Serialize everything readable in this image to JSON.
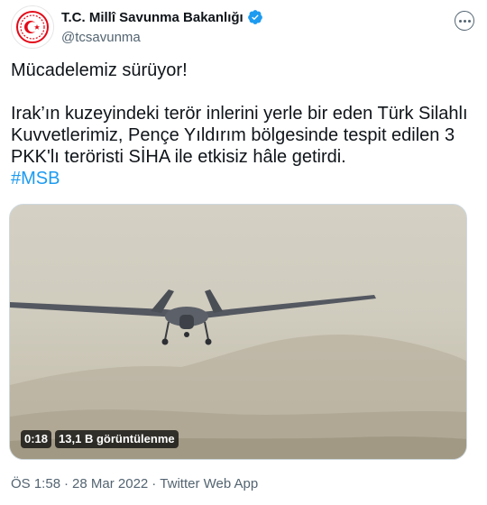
{
  "author": {
    "display_name": "T.C. Millî Savunma Bakanlığı",
    "handle": "@tcsavunma"
  },
  "tweet": {
    "line1": "Mücadelemiz sürüyor!",
    "line2": "Irak’ın kuzeyindeki terör inlerini yerle bir eden Türk Silahlı Kuvvetlerimiz, Pençe Yıldırım bölgesinde tespit edilen 3 PKK'lı teröristi SİHA ile etkisiz hâle getirdi.",
    "hashtag": "#MSB"
  },
  "video": {
    "duration": "0:18",
    "views": "13,1 B görüntülenme"
  },
  "meta": {
    "time": "ÖS 1:58",
    "sep1": "·",
    "date": "28 Mar 2022",
    "sep2": "·",
    "source": "Twitter Web App"
  },
  "colors": {
    "link": "#1d9bf0",
    "verified": "#1d9bf0",
    "secondary_text": "#536471",
    "emblem_red": "#e30a17"
  },
  "icons": {
    "verified": "verified-badge-icon",
    "more": "more-options-icon",
    "avatar": "ministry-emblem"
  }
}
